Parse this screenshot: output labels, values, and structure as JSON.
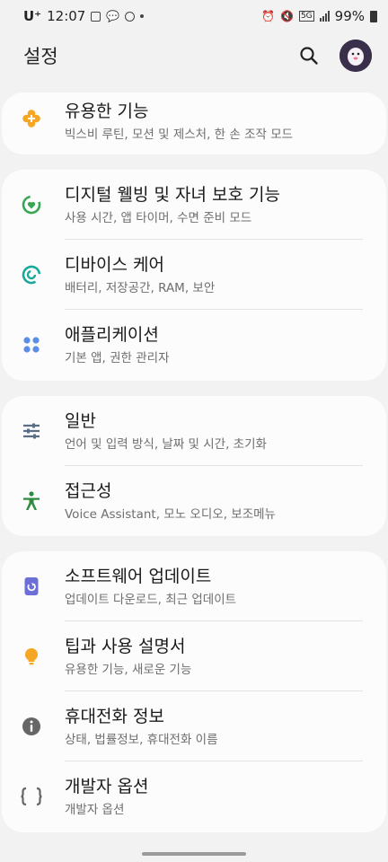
{
  "status": {
    "carrier": "U⁺",
    "time": "12:07",
    "network_badge": "5G",
    "battery": "99%"
  },
  "header": {
    "title": "설정"
  },
  "sections": [
    {
      "items": [
        {
          "title": "유용한 기능",
          "subtitle": "빅스비 루틴, 모션 및 제스처, 한 손 조작 모드",
          "icon": "plus-flower-icon"
        }
      ]
    },
    {
      "items": [
        {
          "title": "디지털 웰빙 및 자녀 보호 기능",
          "subtitle": "사용 시간, 앱 타이머, 수면 준비 모드",
          "icon": "digital-wellbeing-icon"
        },
        {
          "title": "디바이스 케어",
          "subtitle": "배터리, 저장공간, RAM, 보안",
          "icon": "device-care-icon"
        },
        {
          "title": "애플리케이션",
          "subtitle": "기본 앱, 권한 관리자",
          "icon": "apps-grid-icon"
        }
      ]
    },
    {
      "items": [
        {
          "title": "일반",
          "subtitle": "언어 및 입력 방식, 날짜 및 시간, 초기화",
          "icon": "sliders-icon"
        },
        {
          "title": "접근성",
          "subtitle": "Voice Assistant, 모노 오디오, 보조메뉴",
          "icon": "accessibility-icon"
        }
      ]
    },
    {
      "items": [
        {
          "title": "소프트웨어 업데이트",
          "subtitle": "업데이트 다운로드, 최근 업데이트",
          "icon": "software-update-icon"
        },
        {
          "title": "팁과 사용 설명서",
          "subtitle": "유용한 기능, 새로운 기능",
          "icon": "lightbulb-icon"
        },
        {
          "title": "휴대전화 정보",
          "subtitle": "상태, 법률정보, 휴대전화 이름",
          "icon": "info-icon"
        },
        {
          "title": "개발자 옵션",
          "subtitle": "개발자 옵션",
          "icon": "braces-icon"
        }
      ]
    }
  ],
  "colors": {
    "background": "#f2f2f2",
    "card": "#fcfcfc",
    "subtitle": "#6e6e6e",
    "orange": "#f5a623",
    "green": "#3aa655",
    "teal": "#1aa89a",
    "blue": "#5b8fe6",
    "slate": "#5a6f86",
    "purple": "#6b6fd6"
  }
}
